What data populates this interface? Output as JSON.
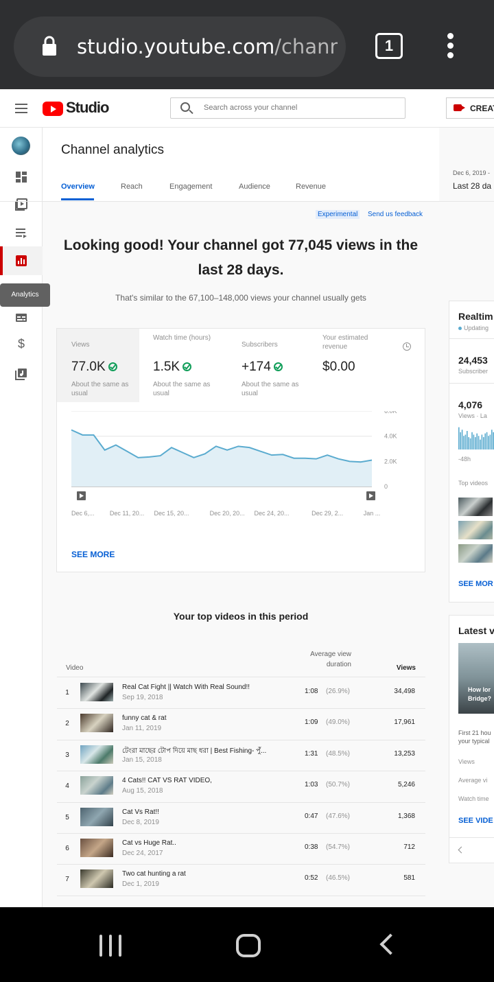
{
  "browser": {
    "url_main": "studio.youtube.com",
    "url_rest": "/channe",
    "tab_count": "1"
  },
  "header": {
    "logo_text": "Studio",
    "search_placeholder": "Search across your channel",
    "create_label": "CREAT"
  },
  "sidebar": {
    "tooltip": "Analytics"
  },
  "page": {
    "title": "Channel analytics",
    "tabs": [
      "Overview",
      "Reach",
      "Engagement",
      "Audience",
      "Revenue"
    ],
    "active_tab": "Overview",
    "date_range": "Dec 6, 2019 -",
    "date_label": "Last 28 da"
  },
  "overview": {
    "experimental": "Experimental",
    "feedback": "Send us feedback",
    "headline": "Looking good! Your channel got 77,045 views in the last 28 days.",
    "subline": "That's similar to the 67,100–148,000 views your channel usually gets",
    "metrics": [
      {
        "label": "Views",
        "value": "77.0K",
        "note": "About the same as usual",
        "status": "ok"
      },
      {
        "label": "Watch time (hours)",
        "value": "1.5K",
        "note": "About the same as usual",
        "status": "ok"
      },
      {
        "label": "Subscribers",
        "value": "+174",
        "note": "About the same as usual",
        "status": "ok"
      },
      {
        "label": "Your estimated revenue",
        "value": "$0.00",
        "note": "",
        "status": "none"
      }
    ],
    "see_more": "SEE MORE"
  },
  "chart_data": {
    "type": "area",
    "x": [
      "Dec 6,...",
      "",
      "",
      "",
      "",
      "Dec 11, 20...",
      "",
      "",
      "",
      "Dec 15, 20...",
      "",
      "",
      "",
      "",
      "Dec 20, 20...",
      "",
      "",
      "",
      "Dec 24, 20...",
      "",
      "",
      "",
      "",
      "Dec 29, 2...",
      "",
      "",
      "",
      "Jan ..."
    ],
    "x_tick_labels": [
      "Dec 6,...",
      "Dec 11, 20...",
      "Dec 15, 20...",
      "Dec 20, 20...",
      "Dec 24, 20...",
      "Dec 29, 2...",
      "Jan ..."
    ],
    "series": [
      {
        "values": [
          4500,
          4100,
          4100,
          2900,
          3300,
          2800,
          2300,
          2350,
          2450,
          3100,
          2700,
          2300,
          2600,
          3200,
          2900,
          3200,
          3100,
          2800,
          2500,
          2550,
          2250,
          2250,
          2200,
          2500,
          2200,
          2000,
          1950,
          2100
        ]
      }
    ],
    "y_ticks": [
      "6.0K",
      "4.0K",
      "2.0K",
      "0"
    ],
    "ylim": [
      0,
      6000
    ],
    "color": "#5aabcf",
    "fill": "#e1eff6"
  },
  "top_videos": {
    "title": "Your top videos in this period",
    "col_video": "Video",
    "col_avg": "Average view duration",
    "col_views": "Views",
    "rows": [
      {
        "num": "1",
        "title": "Real Cat Fight || Watch With Real Sound!!",
        "date": "Sep 19, 2018",
        "duration": "1:08",
        "pct": "(26.9%)",
        "views": "34,498"
      },
      {
        "num": "2",
        "title": "funny cat & rat",
        "date": "Jan 11, 2019",
        "duration": "1:09",
        "pct": "(49.0%)",
        "views": "17,961"
      },
      {
        "num": "3",
        "title": "টেংরা মাছের টোপ দিয়ে মাছ ধরা | Best Fishing- পুঁ...",
        "date": "Jan 15, 2018",
        "duration": "1:31",
        "pct": "(48.5%)",
        "views": "13,253"
      },
      {
        "num": "4",
        "title": "4 Cats!! CAT VS RAT VIDEO,",
        "date": "Aug 15, 2018",
        "duration": "1:03",
        "pct": "(50.7%)",
        "views": "5,246"
      },
      {
        "num": "5",
        "title": "Cat Vs Rat!!",
        "date": "Dec 8, 2019",
        "duration": "0:47",
        "pct": "(47.6%)",
        "views": "1,368"
      },
      {
        "num": "6",
        "title": "Cat vs Huge Rat..",
        "date": "Dec 24, 2017",
        "duration": "0:38",
        "pct": "(54.7%)",
        "views": "712"
      },
      {
        "num": "7",
        "title": "Two cat hunting a rat",
        "date": "Dec 1, 2019",
        "duration": "0:52",
        "pct": "(46.5%)",
        "views": "581"
      }
    ]
  },
  "realtime": {
    "title": "Realtim",
    "updating": "Updating",
    "subs_value": "24,453",
    "subs_label": "Subscriber",
    "views_value": "4,076",
    "views_label": "Views · La",
    "hours_label": "-48h",
    "top_videos": "Top videos",
    "see_more": "SEE MOR"
  },
  "latest": {
    "title": "Latest v",
    "thumb_caption_1": "How lor",
    "thumb_caption_2": "Bridge?",
    "desc_1": "First 21 hou",
    "desc_2": "your typical",
    "stat_views": "Views",
    "stat_avg": "Average vi",
    "stat_watch": "Watch time",
    "see_video": "SEE VIDE"
  }
}
